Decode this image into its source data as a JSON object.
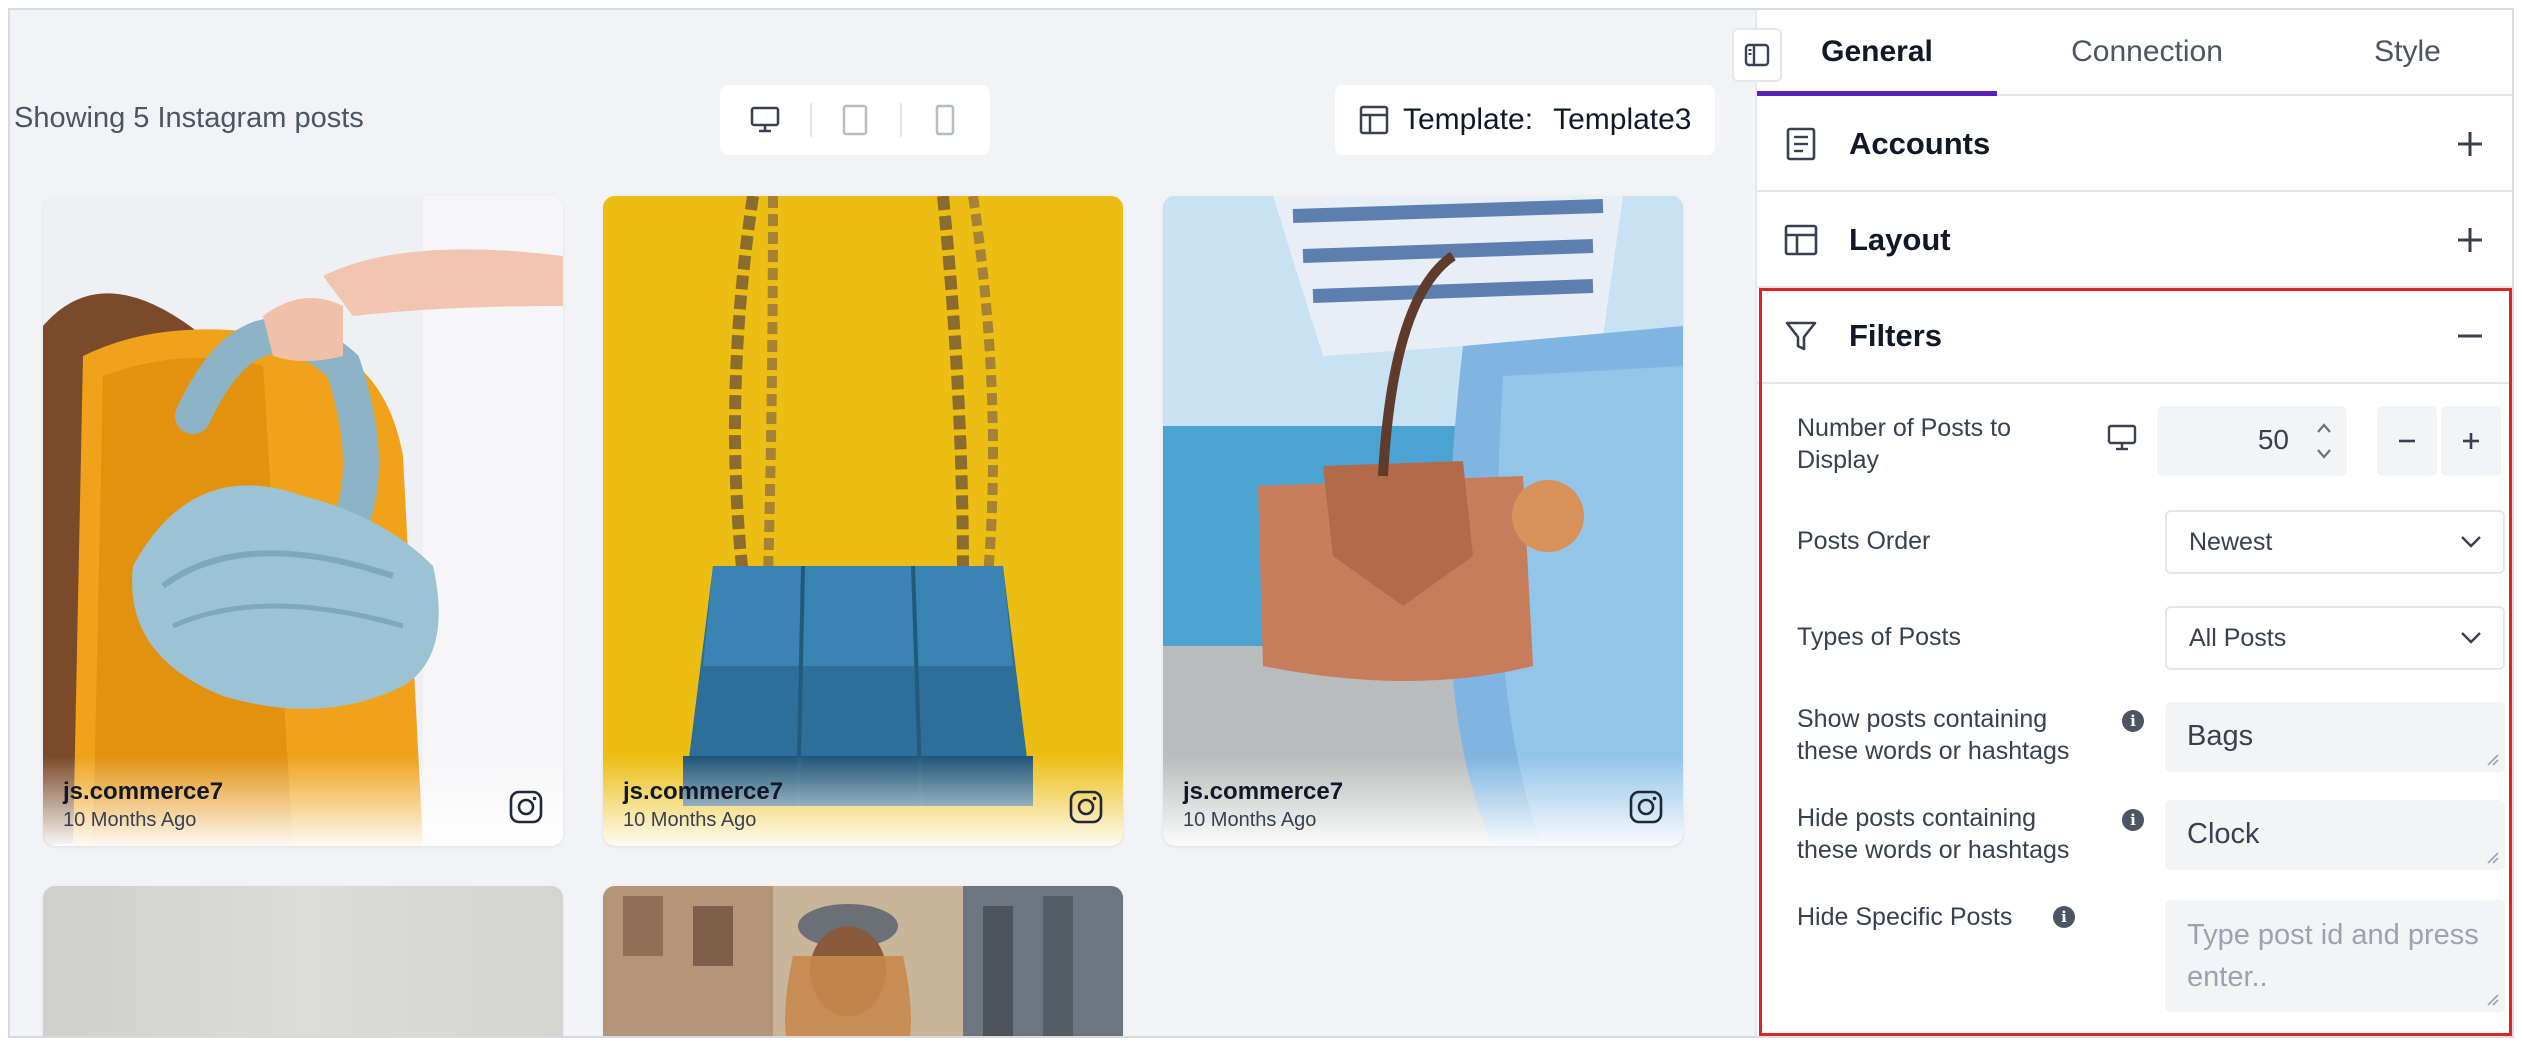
{
  "preview": {
    "showing_text": "Showing 5 Instagram posts",
    "device_toggle": [
      "desktop-icon",
      "tablet-icon",
      "mobile-icon"
    ],
    "template_label": "Template:",
    "template_value": "Template3"
  },
  "posts": [
    {
      "user": "js.commerce7",
      "time": "10 Months Ago"
    },
    {
      "user": "js.commerce7",
      "time": "10 Months Ago"
    },
    {
      "user": "js.commerce7",
      "time": "10 Months Ago"
    }
  ],
  "panel": {
    "tabs": [
      "General",
      "Connection",
      "Style"
    ],
    "active_tab": "General",
    "sections": {
      "accounts": "Accounts",
      "layout": "Layout",
      "filters": "Filters"
    },
    "filters": {
      "num_posts_label": "Number of Posts to Display",
      "num_posts_value": "50",
      "posts_order_label": "Posts Order",
      "posts_order_value": "Newest",
      "types_label": "Types of Posts",
      "types_value": "All Posts",
      "show_label": "Show posts containing these words or hashtags",
      "show_value": "Bags",
      "hide_label": "Hide posts containing these words or hashtags",
      "hide_value": "Clock",
      "hide_specific_label": "Hide Specific Posts",
      "hide_specific_placeholder": "Type post id and press enter.."
    }
  },
  "colors": {
    "accent": "#5b21b6",
    "highlight": "#dc2626",
    "background": "#f2f3f7"
  }
}
